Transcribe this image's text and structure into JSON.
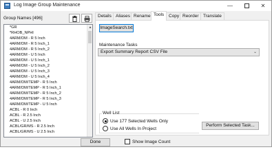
{
  "window": {
    "title": "Log Image Group Maintenance"
  },
  "left_panel": {
    "group_names_label": "Group Names [496]",
    "items": [
      "*GR",
      "*RHOB_NPHI",
      "4ARM/DM - R 5 Inch",
      "4ARM/DM - R 5 Inch_1",
      "4ARM/DM - R 5 Inch_2",
      "4ARM/DM - U 5 Inch",
      "4ARM/DM - U 5 Inch_1",
      "4ARM/DM - U 5 Inch_2",
      "4ARM/DM - U 5 Inch_3",
      "4ARM/DM - U 5 Inch_4",
      "4ARM/DM/TEMP - R 5 Inch",
      "4ARM/DM/TEMP - R 5 Inch_1",
      "4ARM/DM/TEMP - R 5 Inch_2",
      "4ARM/DM/TEMP - R 5 Inch_3",
      "4ARM/DM/TEMP - U 5 Inch",
      "ACBL - R 0 Inch",
      "ACBL - R 2.5 Inch",
      "ACBL - U 2.5 Inch",
      "ACBL/GR/MS - R 2.5 Inch",
      "ACBL/GR/MS - U 2.5 Inch"
    ]
  },
  "tabs": [
    "Details",
    "Aliases",
    "Rename",
    "Tools",
    "Copy",
    "Reorder",
    "Translate"
  ],
  "tools_tab": {
    "imagesearch_button": "ImageSearch.txt",
    "maintenance_tasks_label": "Maintenance Tasks",
    "maintenance_task_selected": "Export Summary Report CSV File",
    "well_list_label": "Well List",
    "radio_selected_wells": "Use 177 Selected Wells Only",
    "radio_all_wells": "Use All Wells In Project",
    "perform_button": "Perform Selected Task..."
  },
  "footer": {
    "done_button": "Done",
    "show_image_count_label": "Show Image Count"
  }
}
